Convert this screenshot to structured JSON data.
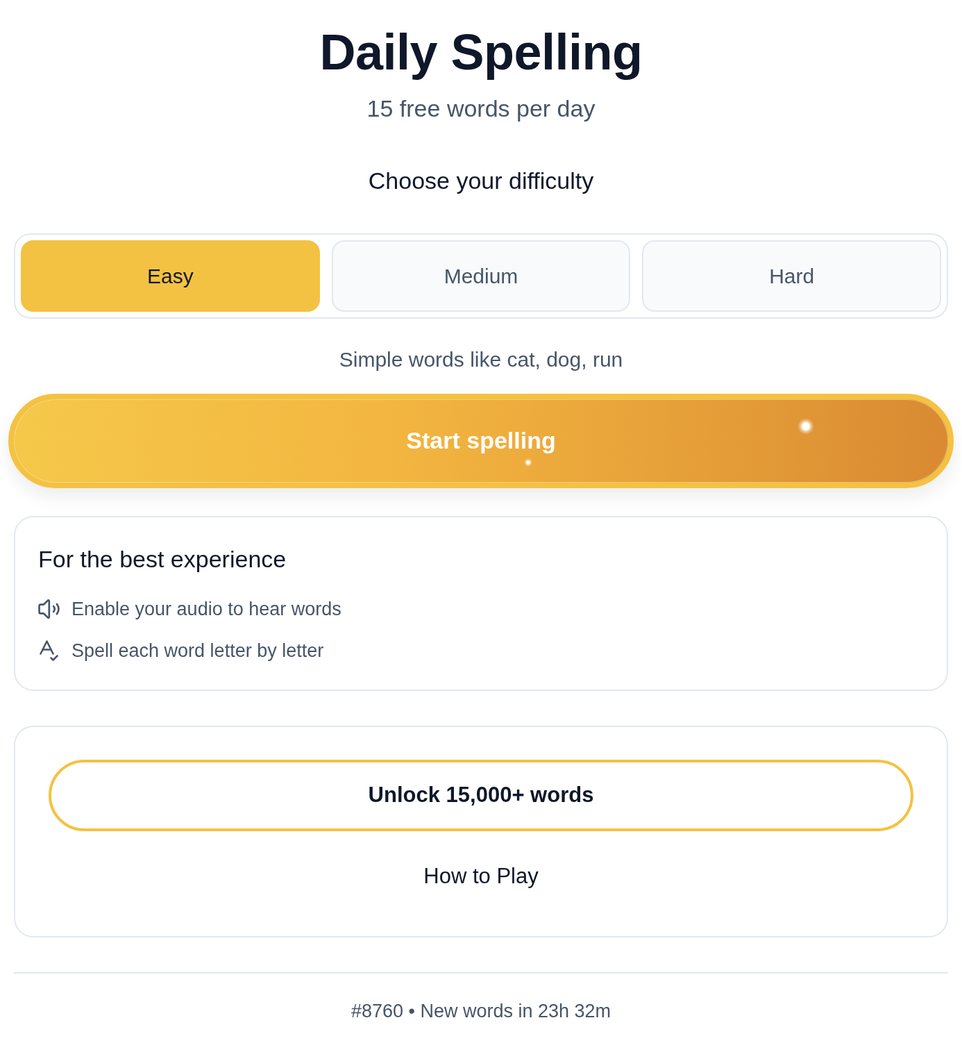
{
  "header": {
    "title": "Daily Spelling",
    "subtitle": "15 free words per day"
  },
  "difficulty": {
    "heading": "Choose your difficulty",
    "options": [
      {
        "label": "Easy",
        "selected": true
      },
      {
        "label": "Medium",
        "selected": false
      },
      {
        "label": "Hard",
        "selected": false
      }
    ],
    "description": "Simple words like cat, dog, run"
  },
  "start_button": {
    "label": "Start spelling"
  },
  "tips_card": {
    "title": "For the best experience",
    "items": [
      {
        "kind": "audio",
        "text": "Enable your audio to hear words"
      },
      {
        "kind": "spelling",
        "text": "Spell each word letter by letter"
      }
    ]
  },
  "actions_card": {
    "unlock_button": "Unlock 15,000+ words",
    "how_to_play": "How to Play"
  },
  "footer": {
    "text": "#8760 • New words in 23h 32m"
  }
}
